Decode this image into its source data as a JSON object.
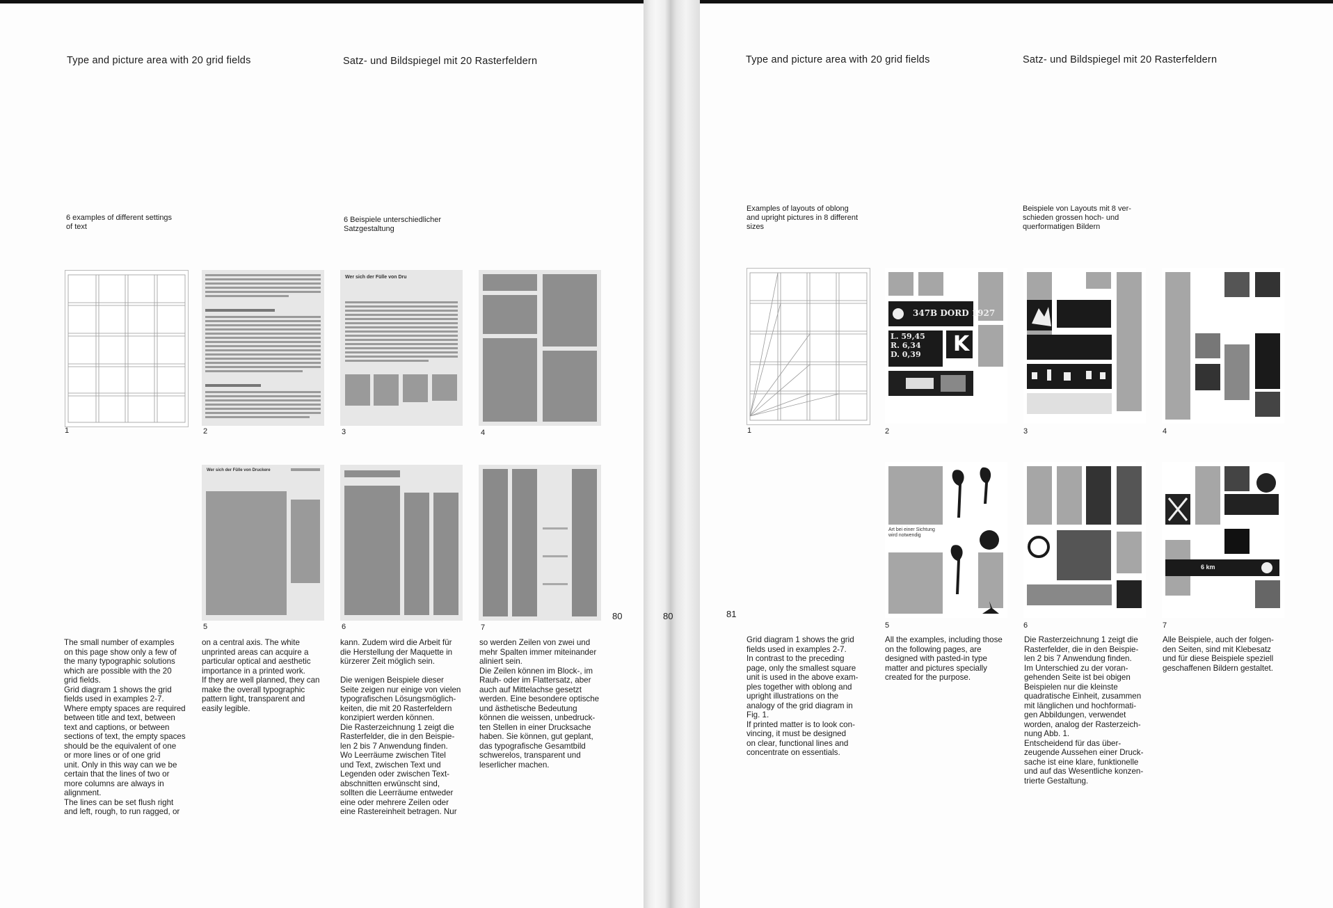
{
  "left_page": {
    "heading_en": "Type and picture area with 20 grid fields",
    "heading_de": "Satz- und Bildspiegel mit 20 Rasterfeldern",
    "caption_en": [
      "6 examples of different settings",
      "of text"
    ],
    "caption_de": [
      "6 Beispiele unterschiedlicher",
      "Satzgestaltung"
    ],
    "figure_numbers": [
      "1",
      "2",
      "3",
      "4",
      "5",
      "6",
      "7"
    ],
    "folio": "80",
    "text_col1": [
      "The small number of examples",
      "on this page show only a few of",
      "the many typographic solutions",
      "which are possible with the 20",
      "grid fields.",
      "Grid diagram 1 shows the grid",
      "fields used in examples 2-7.",
      "Where empty spaces are required",
      "between title and text, between",
      "text and captions, or between",
      "sections of text, the empty spaces",
      "should be the equivalent of one",
      "or more lines or of one grid",
      "unit. Only in this way can we be",
      "certain that the lines of two or",
      "more columns are always in",
      "alignment.",
      "The lines can be set flush right",
      "and left, rough, to run ragged, or"
    ],
    "text_col2": [
      "on a central axis. The white",
      "unprinted areas can acquire a",
      "particular optical and aesthetic",
      "importance in a printed work.",
      "If they are well planned, they can",
      "make the overall typographic",
      "pattern light, transparent and",
      "easily legible."
    ],
    "text_col3": [
      "kann. Zudem wird die Arbeit für",
      "die Herstellung der Maquette in",
      "kürzerer Zeit möglich sein.",
      "",
      "Die wenigen Beispiele dieser",
      "Seite zeigen nur einige von vielen",
      "typografischen Lösungsmöglich-",
      "keiten, die mit 20 Rasterfeldern",
      "konzipiert werden können.",
      "Die Rasterzeichnung 1 zeigt die",
      "Rasterfelder, die in den Beispie-",
      "len 2 bis 7 Anwendung finden.",
      "Wo Leerräume zwischen Titel",
      "und Text, zwischen Text und",
      "Legenden oder zwischen Text-",
      "abschnitten erwünscht sind,",
      "sollten die Leerräume entweder",
      "eine oder mehrere Zeilen oder",
      "eine Rastereinheit betragen. Nur"
    ],
    "text_col4": [
      "so werden Zeilen von zwei und",
      "mehr Spalten immer miteinander",
      "aliniert sein.",
      "Die Zeilen können im Block-, im",
      "Rauh- oder im Flattersatz, aber",
      "auch auf Mittelachse gesetzt",
      "werden. Eine besondere optische",
      "und ästhetische Bedeutung",
      "können die weissen, unbedruck-",
      "ten Stellen in einer Drucksache",
      "haben. Sie können, gut geplant,",
      "das typografische Gesamtbild",
      "schwerelos, transparent und",
      "leserlicher machen."
    ]
  },
  "gutter": {
    "folio": "80"
  },
  "right_page": {
    "heading_en": "Type and picture area with 20 grid fields",
    "heading_de": "Satz- und Bildspiegel mit 20 Rasterfeldern",
    "caption_en": [
      "Examples of layouts of oblong",
      "and upright pictures in 8 different",
      "sizes"
    ],
    "caption_de": [
      "Beispiele von Layouts mit 8 ver-",
      "schieden grossen hoch- und",
      "querformatigen Bildern"
    ],
    "figure_numbers": [
      "1",
      "2",
      "3",
      "4",
      "5",
      "6",
      "7"
    ],
    "folio": "81",
    "thumb2_banner": "347B DORD 1927",
    "thumb2_letter": "K",
    "thumb2_numbers": [
      "L. 59,45",
      "R. 6,34",
      "D. 0,39"
    ],
    "thumb5_caption": [
      "Art bei einer Sichtung",
      "wird notwendig"
    ],
    "thumb7_sign": "6 km",
    "text_col1": [
      "Grid diagram 1 shows the grid",
      "fields used in examples 2-7.",
      "In contrast to the preceding",
      "page, only the smallest square",
      "unit is used in the above exam-",
      "ples together with oblong and",
      "upright illustrations on the",
      "analogy of the grid diagram in",
      "Fig. 1.",
      "If printed matter is to look con-",
      "vincing, it must be designed",
      "on clear, functional lines and",
      "concentrate on essentials."
    ],
    "text_col2": [
      "All the examples, including those",
      "on the following pages, are",
      "designed with pasted-in type",
      "matter and pictures specially",
      "created for the purpose."
    ],
    "text_col3": [
      "Die Rasterzeichnung 1 zeigt die",
      "Rasterfelder, die in den Beispie-",
      "len 2 bis 7 Anwendung finden.",
      "Im Unterschied zu der voran-",
      "gehenden Seite ist bei obigen",
      "Beispielen nur die kleinste",
      "quadratische Einheit, zusammen",
      "mit länglichen und hochformati-",
      "gen Abbildungen, verwendet",
      "worden, analog der Rasterzeich-",
      "nung Abb. 1.",
      "Entscheidend für das über-",
      "zeugende Aussehen einer Druck-",
      "sache ist eine klare, funktionelle",
      "und auf das Wesentliche konzen-",
      "trierte Gestaltung."
    ],
    "text_col4": [
      "Alle Beispiele, auch der folgen-",
      "den Seiten, sind mit Klebesatz",
      "und für diese Beispiele speziell",
      "geschaffenen Bildern gestaltet."
    ]
  },
  "thumb_text": {
    "l3_title": "Wer sich der Fülle von Dru",
    "l5_title": "Wer sich der Fülle von Druckere"
  }
}
